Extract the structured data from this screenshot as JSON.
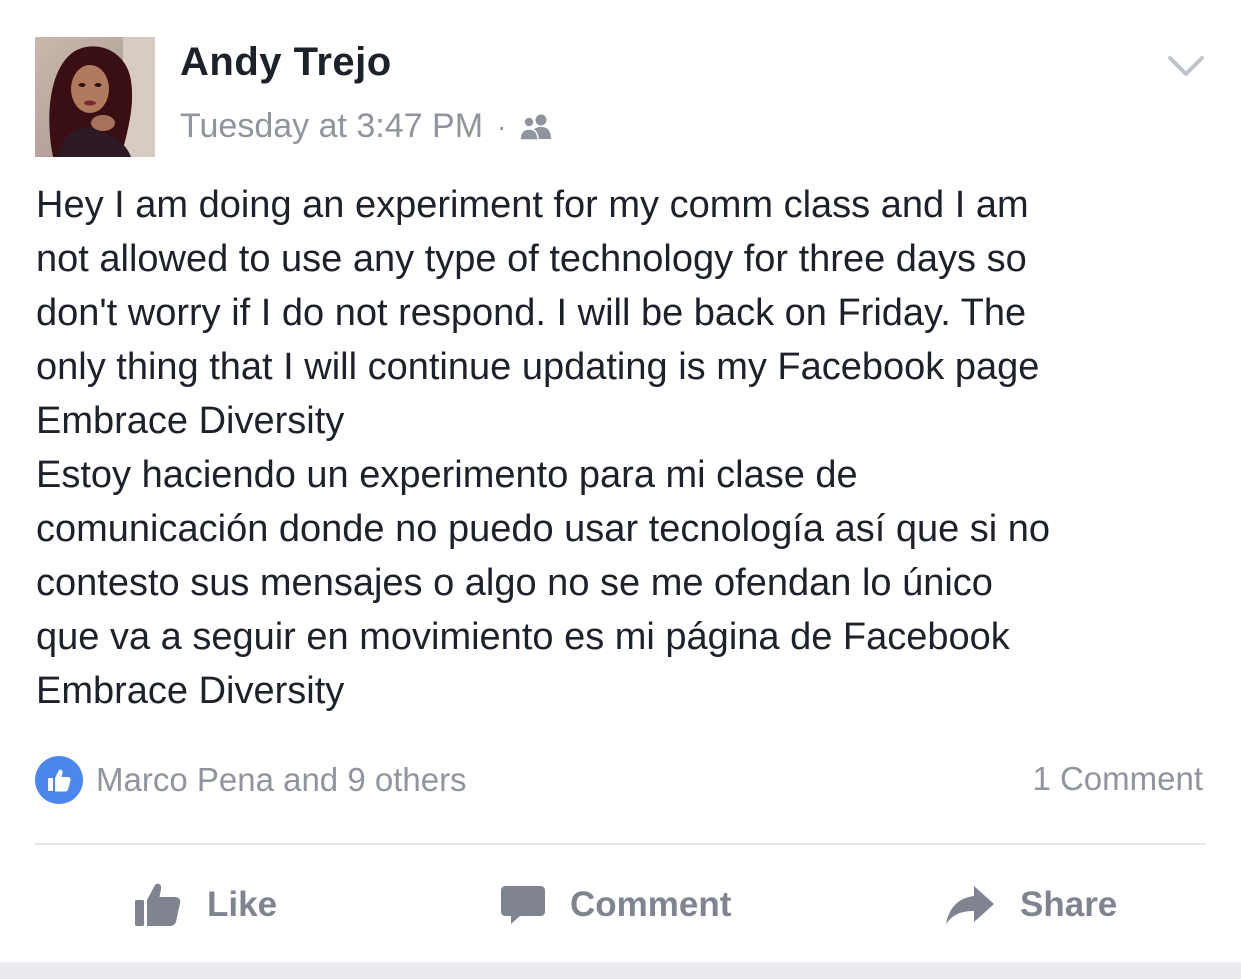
{
  "post": {
    "author": "Andy Trejo",
    "timestamp": "Tuesday at 3:47 PM",
    "separator": "·",
    "audience_icon": "friends-icon",
    "options_icon": "chevron-down-icon",
    "text": "Hey I am doing an experiment for my comm class and I am\nnot allowed to use any type of technology for three days so\ndon't worry if I do not respond. I will be back on Friday. The\nonly thing that I will continue updating is my Facebook page\nEmbrace Diversity\nEstoy haciendo un experimento para mi clase de\ncomunicación donde no puedo usar tecnología así que si no\ncontesto sus mensajes o algo no se me ofendan lo único\nque va a seguir en movimiento es mi página de Facebook\nEmbrace Diversity"
  },
  "reactions": {
    "icon": "like-badge-icon",
    "summary": "Marco Pena and 9 others",
    "comments": "1 Comment"
  },
  "actions": {
    "like": "Like",
    "comment": "Comment",
    "share": "Share"
  },
  "colors": {
    "text": "#1d2129",
    "secondary": "#90949c",
    "like_blue": "#4a88ed",
    "action_gray": "#7f8490"
  }
}
